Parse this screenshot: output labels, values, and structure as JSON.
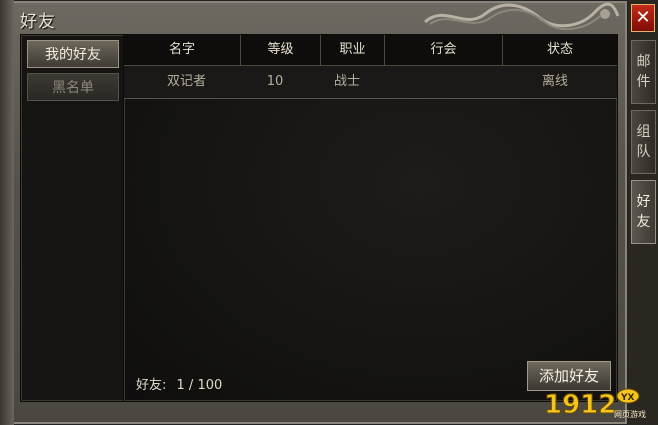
{
  "window": {
    "title": "好友",
    "close_label": "✕"
  },
  "left_tabs": {
    "my_friends": "我的好友",
    "blacklist": "黑名单"
  },
  "table": {
    "headers": [
      "名字",
      "等级",
      "职业",
      "行会",
      "状态"
    ],
    "rows": [
      {
        "name": "双记者",
        "level": "10",
        "job": "战士",
        "guild": "",
        "status": "离线"
      }
    ]
  },
  "footer": {
    "count_label": "好友:",
    "count_value": "1 / 100",
    "add_button": "添加好友"
  },
  "right_tabs": [
    {
      "chars": [
        "邮",
        "件"
      ]
    },
    {
      "chars": [
        "组",
        "队"
      ]
    },
    {
      "chars": [
        "好",
        "友"
      ]
    }
  ],
  "logo": {
    "text": "1912",
    "badge": "YX",
    "sub": "网页游戏"
  }
}
